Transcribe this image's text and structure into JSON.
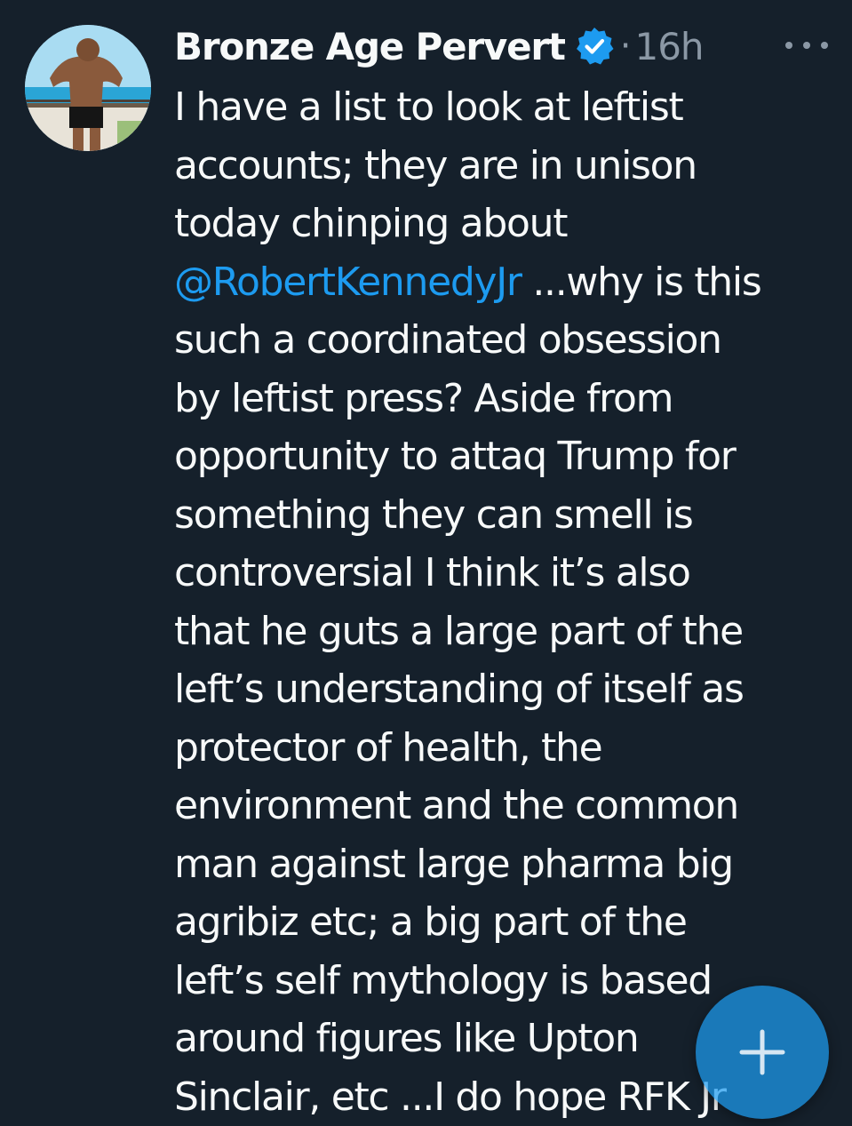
{
  "author": {
    "name": "Bronze Age Pervert",
    "verified_icon": "verified-badge-icon",
    "separator": "·",
    "time": "16h"
  },
  "more_icon": "more-horizontal-icon",
  "tweet": {
    "lines": [
      "I have a list to look at leftist",
      "accounts; they are in unison",
      "today chinping about",
      "...why is this",
      "such a coordinated obsession",
      "by leftist press? Aside from",
      "opportunity to attaq Trump for",
      "something they can smell is",
      "controversial I think it’s also",
      "that he guts a large part of the",
      "left’s understanding of itself as",
      "protector of health, the",
      "environment and the common",
      "man against large pharma big",
      "agribiz etc; a big part of the",
      "left’s self mythology is based",
      "around figures like Upton",
      "Sinclair, etc ...I do hope RFK Jr"
    ],
    "mention": "@RobertKennedyJr"
  },
  "compose_icon": "plus-icon",
  "colors": {
    "background": "#15202b",
    "text": "#f7f9f9",
    "secondary": "#8b98a5",
    "accent": "#1d9bf0"
  }
}
